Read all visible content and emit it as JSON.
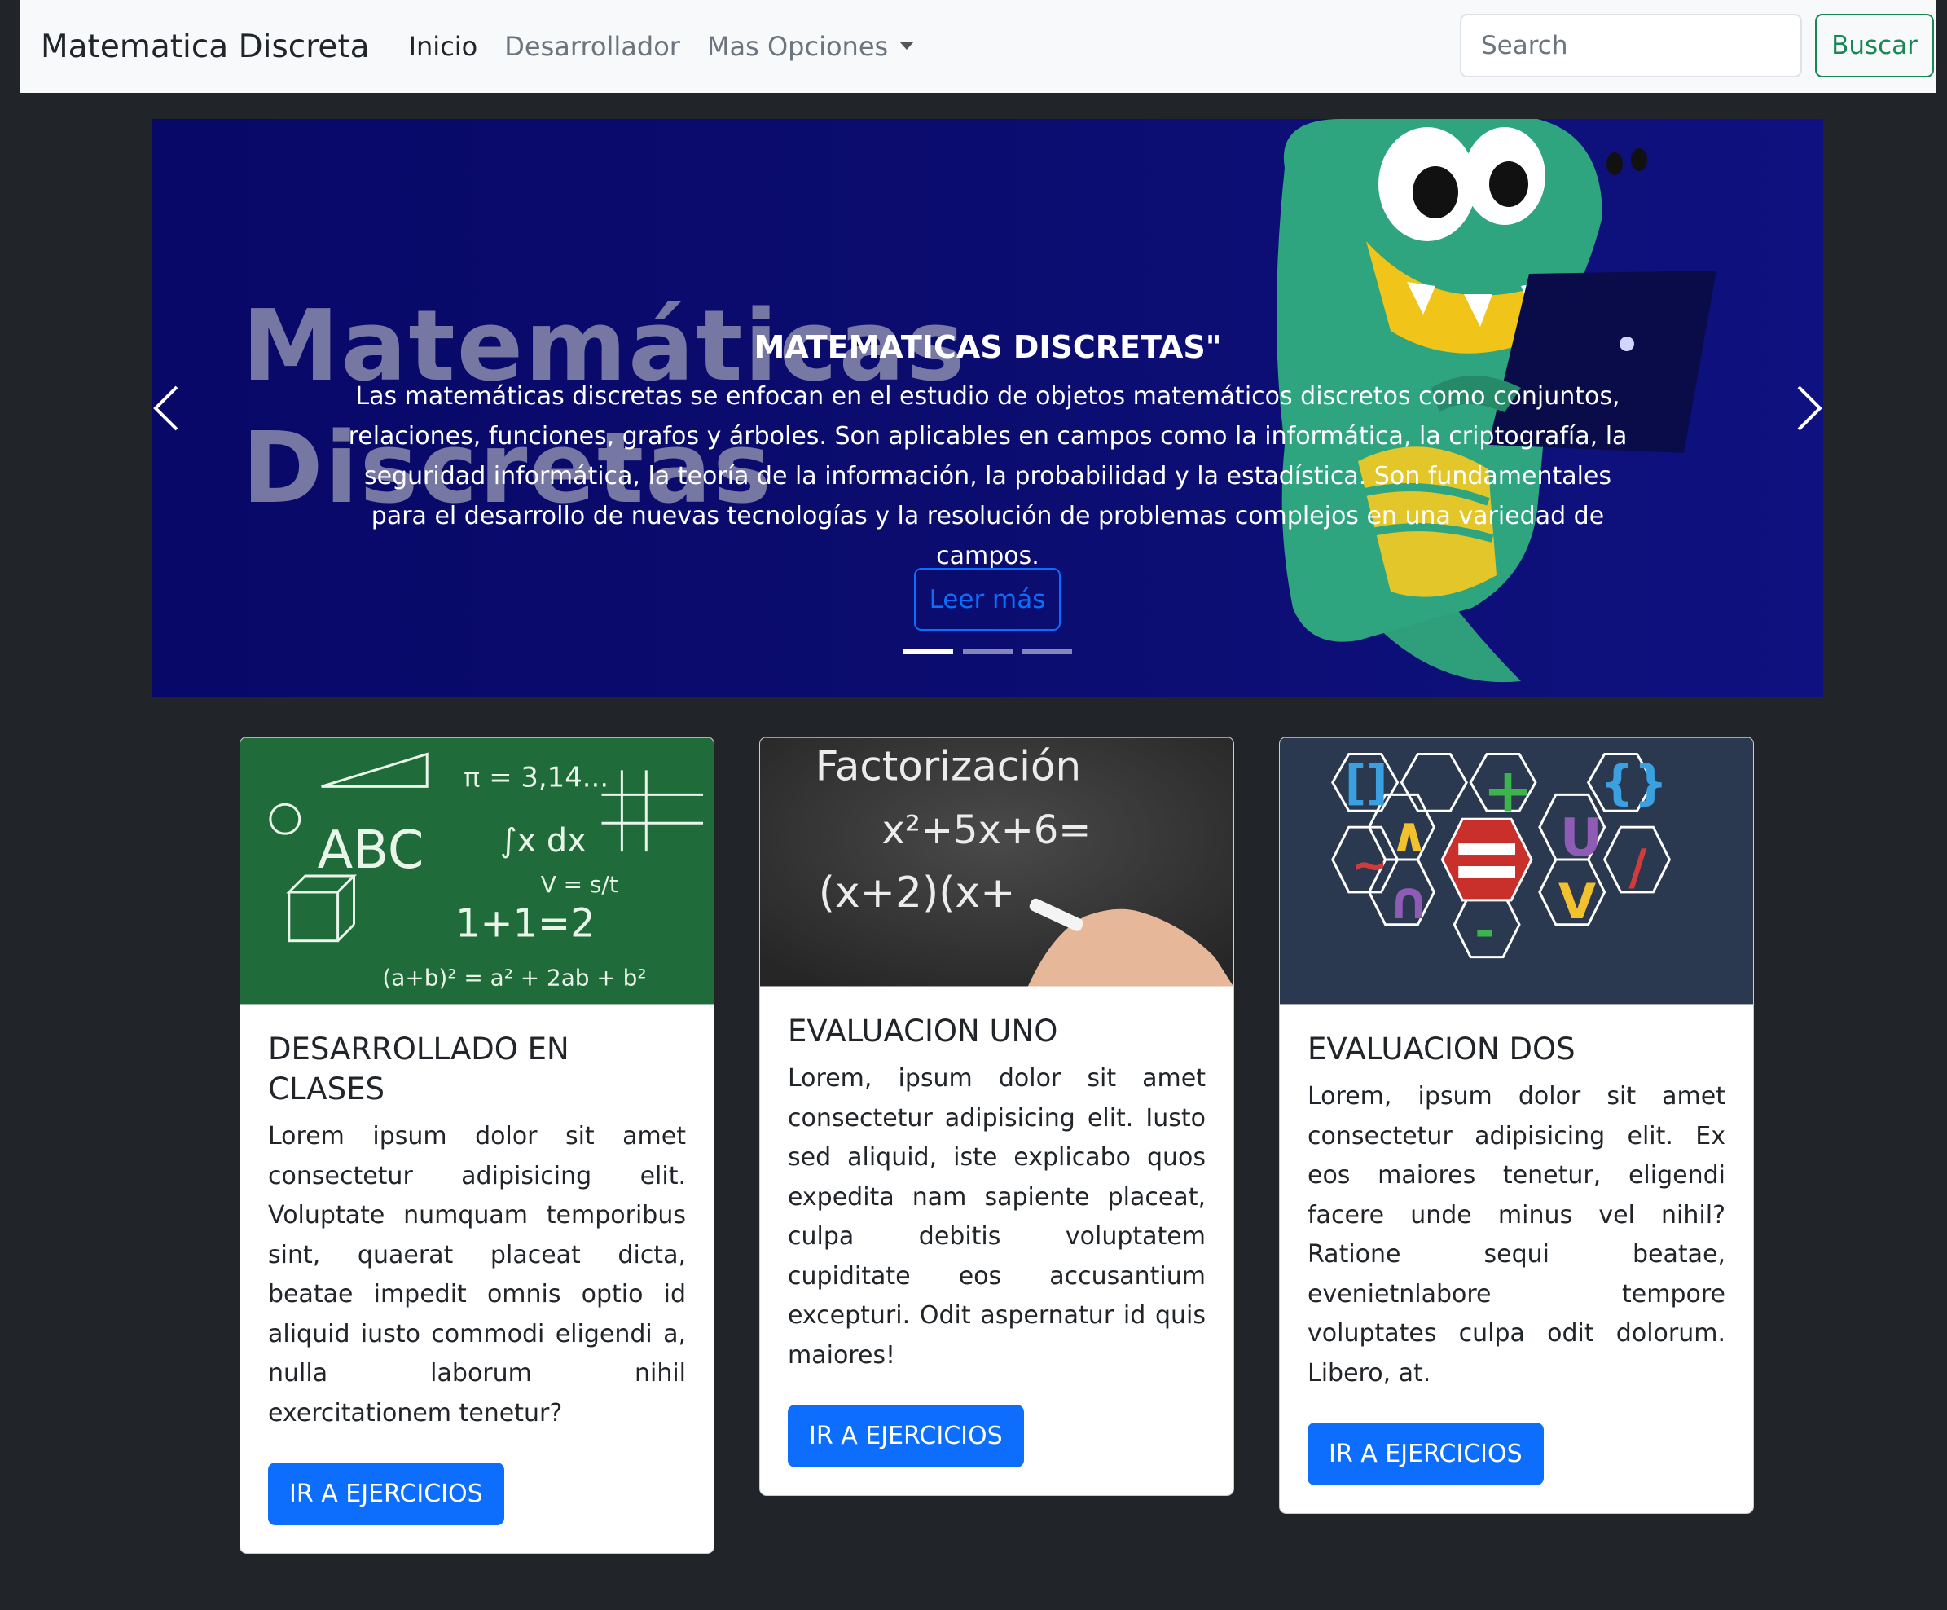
{
  "navbar": {
    "brand": "Matematica Discreta",
    "links": [
      "Inicio",
      "Desarrollador",
      "Mas Opciones"
    ],
    "search_placeholder": "Search",
    "search_button": "Buscar"
  },
  "carousel": {
    "background_text_line1": "Matemáticas",
    "background_text_line2": "Discretas",
    "title": "MATEMATICAS DISCRETAS\"",
    "text": "Las matemáticas discretas se enfocan en el estudio de objetos matemáticos discretos como conjuntos, relaciones, funciones, grafos y árboles. Son aplicables en campos como la informática, la criptografía, la seguridad informática, la teoría de la información, la probabilidad y la estadística. Son fundamentales para el desarrollo de nuevas tecnologías y la resolución de problemas complejos en una variedad de campos.",
    "button": "Leer más",
    "indicator_count": 3,
    "active_indicator": 1
  },
  "cards": [
    {
      "title": "DESARROLLADO EN CLASES",
      "text": "Lorem ipsum dolor sit amet consectetur adipisicing elit. Voluptate numquam temporibus sint, quaerat placeat dicta, beatae impedit omnis optio id aliquid iusto commodi eligendi a, nulla laborum nihil exercitationem tenetur?",
      "button": "IR A EJERCICIOS",
      "image_chalk": [
        "ABC",
        "π = 3,14...",
        "1+1=2",
        "∫x dx",
        "(a+b)² = a² + 2ab + b²",
        "V = s/t"
      ]
    },
    {
      "title": "EVALUACION UNO",
      "text": "Lorem, ipsum dolor sit amet consectetur adipisicing elit. Iusto sed aliquid, iste explicabo quos expedita nam sapiente placeat, culpa debitis voluptatem cupiditate eos accusantium excepturi. Odit aspernatur id quis maiores!",
      "button": "IR A EJERCICIOS",
      "image_chalk": [
        "Factorización",
        "x²+5x+6=",
        "(x+2)(x+"
      ]
    },
    {
      "title": "EVALUACION DOS",
      "text": "Lorem, ipsum dolor sit amet consectetur adipisicing elit. Ex eos maiores tenetur, eligendi facere unde minus vel nihil? Ratione sequi beatae, evenietnlabore tempore voluptates culpa odit dolorum. Libero, at.",
      "button": "IR A EJERCICIOS",
      "image_symbols": [
        "[]",
        "+",
        "{}",
        "∧",
        "U",
        "~",
        "/",
        "∩",
        "V",
        "-"
      ]
    }
  ],
  "colors": {
    "page_bg": "#212529",
    "navbar_bg": "#f8f9fa",
    "primary": "#0d6efd",
    "success": "#198754",
    "carousel_bg": "#0b0c6e"
  }
}
